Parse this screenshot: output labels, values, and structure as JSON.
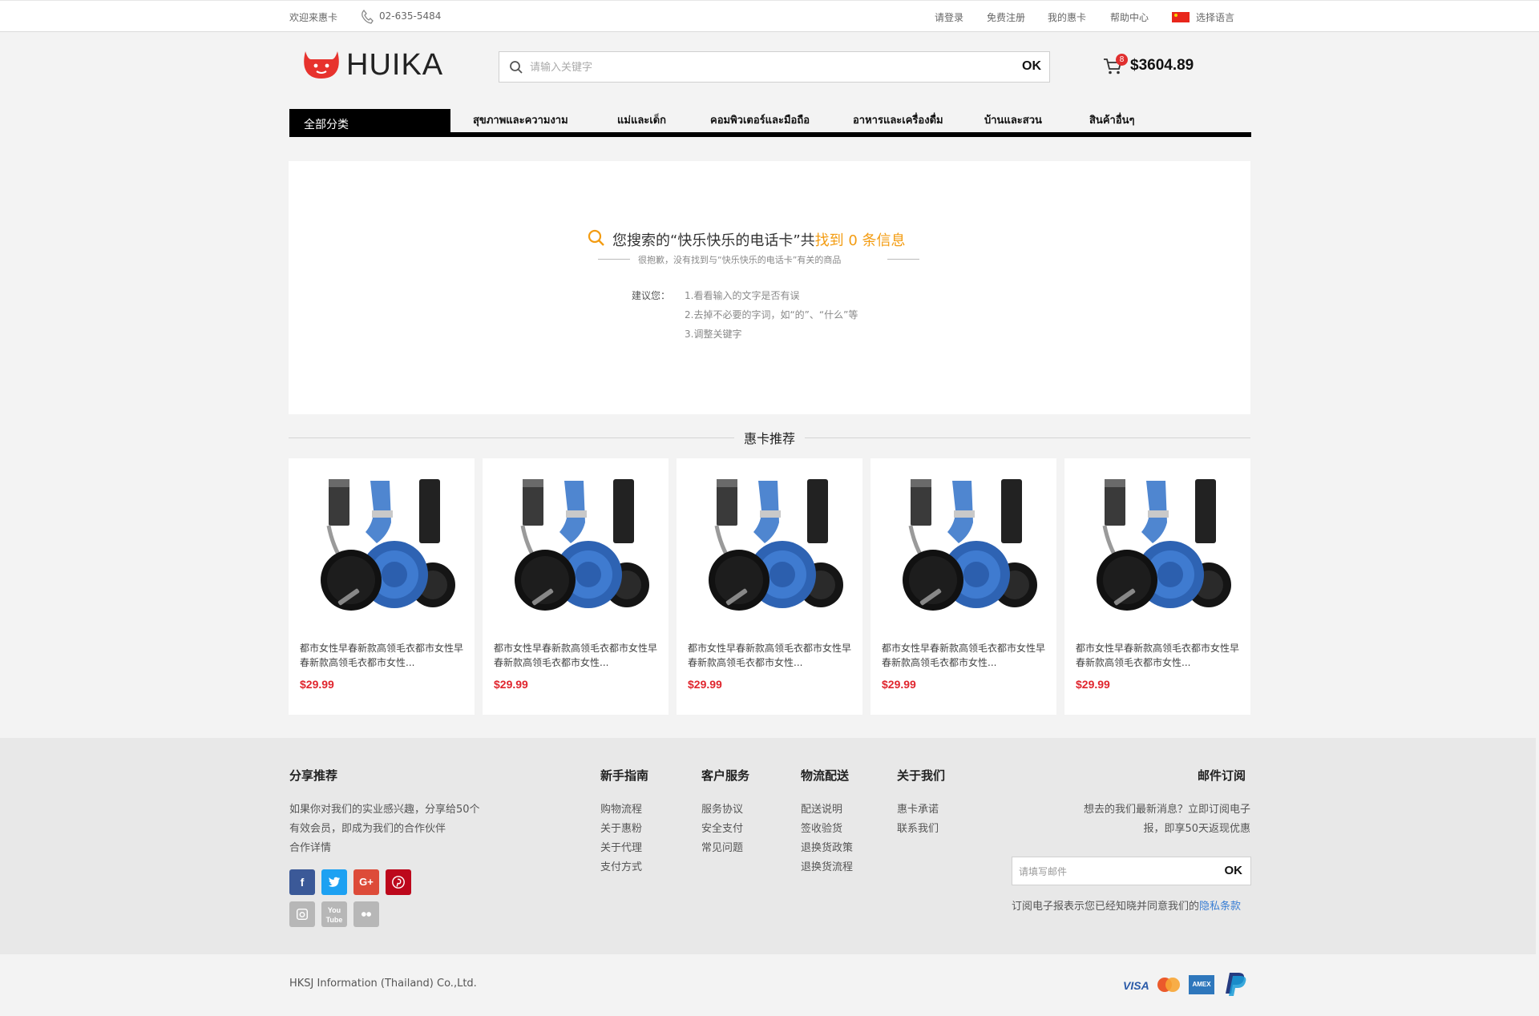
{
  "topbar": {
    "welcome": "欢迎来惠卡",
    "phone": "02-635-5484",
    "links": [
      "请登录",
      "免费注册",
      "我的惠卡",
      "帮助中心"
    ],
    "language": "选择语言"
  },
  "header": {
    "logo_text": "HUIKA",
    "search_placeholder": "请输入关键字",
    "search_button": "OK",
    "cart_count": "8",
    "cart_total": "$3604.89"
  },
  "nav": {
    "all_categories": "全部分类",
    "items": [
      "สุขภาพและความงาม",
      "แม่และเด็ก",
      "คอมพิวเตอร์และมือถือ",
      "อาหารและเครื่องดื่ม",
      "บ้านและสวน",
      "สินค้าอื่นๆ"
    ]
  },
  "result": {
    "title_prefix": "您搜索的“快乐快乐的电话卡”共",
    "title_highlight": "找到 0 条信息",
    "subtitle": "很抱歉，没有找到与“快乐快乐的电话卡”有关的商品",
    "suggest_label": "建议您：",
    "tips": [
      "1.看看输入的文字是否有误",
      "2.去掉不必要的字词，如“的”、“什么”等",
      "3.调整关键字"
    ]
  },
  "recommend": {
    "title": "惠卡推荐",
    "products": [
      {
        "name": "都市女性早春新款高领毛衣都市女性早春新款高领毛衣都市女性...",
        "price": "$29.99"
      },
      {
        "name": "都市女性早春新款高领毛衣都市女性早春新款高领毛衣都市女性...",
        "price": "$29.99"
      },
      {
        "name": "都市女性早春新款高领毛衣都市女性早春新款高领毛衣都市女性...",
        "price": "$29.99"
      },
      {
        "name": "都市女性早春新款高领毛衣都市女性早春新款高领毛衣都市女性...",
        "price": "$29.99"
      },
      {
        "name": "都市女性早春新款高领毛衣都市女性早春新款高领毛衣都市女性...",
        "price": "$29.99"
      }
    ]
  },
  "footer": {
    "share": {
      "title": "分享推荐",
      "lines": [
        "如果你对我们的实业感兴趣，分享给50个",
        "有效会员，即成为我们的合作伙伴",
        "合作详情"
      ]
    },
    "columns": [
      {
        "title": "新手指南",
        "links": [
          "购物流程",
          "关于惠粉",
          "关于代理",
          "支付方式"
        ]
      },
      {
        "title": "客户服务",
        "links": [
          "服务协议",
          "安全支付",
          "常见问题"
        ]
      },
      {
        "title": "物流配送",
        "links": [
          "配送说明",
          "签收验货",
          "退换货政策",
          "退换货流程"
        ]
      },
      {
        "title": "关于我们",
        "links": [
          "惠卡承诺",
          "联系我们"
        ]
      }
    ],
    "subscribe": {
      "title": "邮件订阅",
      "lines": [
        "想去的我们最新消息？立即订阅电子",
        "报，即享50天返现优惠"
      ],
      "placeholder": "请填写邮件",
      "button": "OK",
      "agree_text": "订阅电子报表示您已经知晓并同意我们的",
      "privacy_link": "隐私条款"
    },
    "social_icons": [
      "facebook-icon",
      "twitter-icon",
      "google-plus-icon",
      "pinterest-icon",
      "instagram-icon",
      "youtube-icon",
      "flickr-icon"
    ],
    "copyright": "HKSJ Information (Thailand) Co.,Ltd.",
    "payments": {
      "visa": "VISA",
      "amex": "AMEX"
    }
  },
  "colors": {
    "accent_orange": "#f39c12",
    "price_red": "#e0262e",
    "link_blue": "#3b7fd4"
  }
}
